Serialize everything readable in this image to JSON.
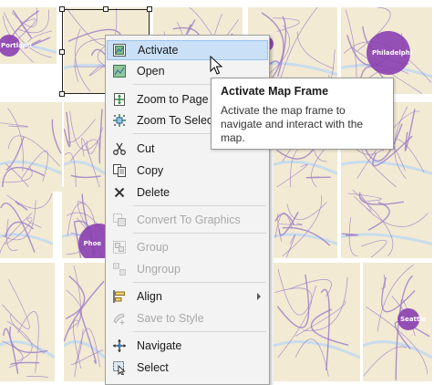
{
  "map_tiles": [
    {
      "city": "Portland"
    },
    {
      "city": ""
    },
    {
      "city": ""
    },
    {
      "city": ""
    },
    {
      "city": "Philadelphi"
    },
    {
      "city": ""
    },
    {
      "city": ""
    },
    {
      "city": ""
    },
    {
      "city": ""
    },
    {
      "city": ""
    },
    {
      "city": ""
    },
    {
      "city": "Phoe"
    },
    {
      "city": ""
    },
    {
      "city": ""
    },
    {
      "city": ""
    },
    {
      "city": ""
    },
    {
      "city": ""
    },
    {
      "city": "Seattle"
    }
  ],
  "context_menu": {
    "items": [
      {
        "label": "Activate",
        "icon": "map-frame-icon",
        "disabled": false
      },
      {
        "label": "Open",
        "icon": "map-open-icon",
        "disabled": false
      },
      {
        "label": "Zoom to Page",
        "icon": "zoom-to-page-icon",
        "disabled": false
      },
      {
        "label": "Zoom To Selected",
        "icon": "zoom-to-selected-icon",
        "disabled": false
      },
      {
        "label": "Cut",
        "icon": "scissors-icon",
        "disabled": false
      },
      {
        "label": "Copy",
        "icon": "copy-icon",
        "disabled": false
      },
      {
        "label": "Delete",
        "icon": "delete-x-icon",
        "disabled": false
      },
      {
        "label": "Convert To Graphics",
        "icon": "convert-graphics-icon",
        "disabled": true
      },
      {
        "label": "Group",
        "icon": "group-icon",
        "disabled": true
      },
      {
        "label": "Ungroup",
        "icon": "ungroup-icon",
        "disabled": true
      },
      {
        "label": "Align",
        "icon": "align-icon",
        "disabled": false
      },
      {
        "label": "Save to Style",
        "icon": "save-style-icon",
        "disabled": true
      },
      {
        "label": "Navigate",
        "icon": "navigate-icon",
        "disabled": false
      },
      {
        "label": "Select",
        "icon": "select-icon",
        "disabled": false
      }
    ]
  },
  "tooltip": {
    "title": "Activate Map Frame",
    "description": "Activate the map frame to navigate and interact with the map."
  },
  "colors": {
    "map_bg": "#f2ead3",
    "road_purple": "#a080c8",
    "city_circle": "#8a3fb0",
    "water": "#c8dcec",
    "menu_hover": "#c9e0f7"
  }
}
